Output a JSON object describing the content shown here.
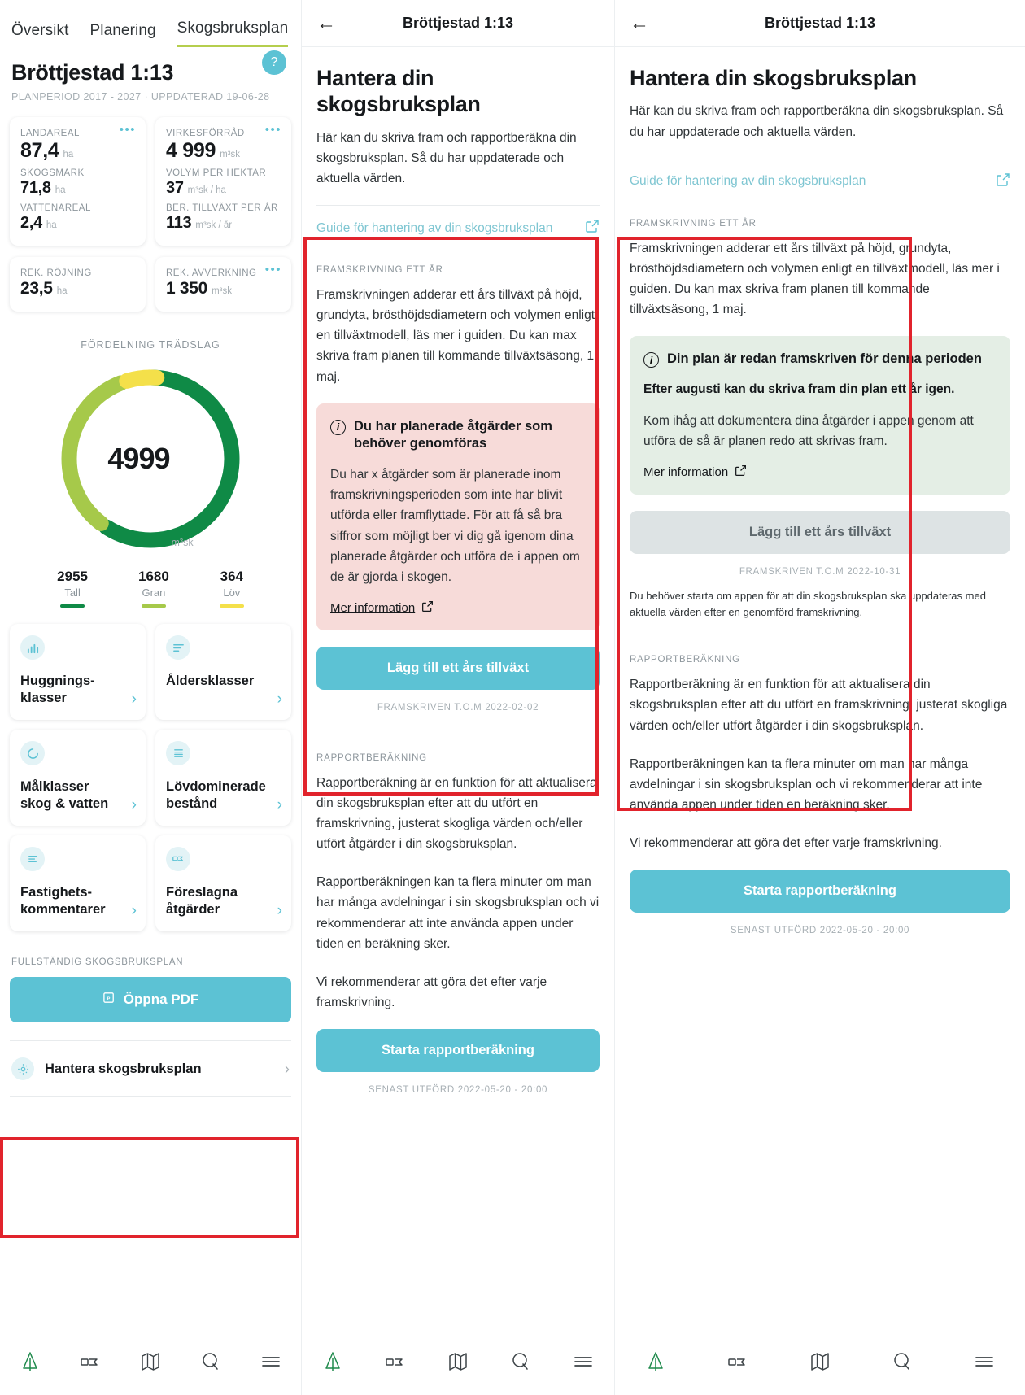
{
  "left": {
    "tabs": [
      {
        "label": "Översikt",
        "active": false
      },
      {
        "label": "Planering",
        "active": false
      },
      {
        "label": "Skogsbruksplan",
        "active": true
      }
    ],
    "title": "Bröttjestad 1:13",
    "subtitle": "PLANPERIOD 2017 - 2027 · UPPDATERAD 19-06-28",
    "help_icon": "?",
    "stats_card_1": [
      {
        "label": "LANDAREAL",
        "value": "87,4",
        "unit": "ha"
      },
      {
        "label": "SKOGSMARK",
        "value": "71,8",
        "unit": "ha"
      },
      {
        "label": "VATTENAREAL",
        "value": "2,4",
        "unit": "ha"
      }
    ],
    "stats_card_2": [
      {
        "label": "VIRKESFÖRRÅD",
        "value": "4 999",
        "unit": "m³sk"
      },
      {
        "label": "VOLYM PER HEKTAR",
        "value": "37",
        "unit": "m³sk / ha"
      },
      {
        "label": "BER. TILLVÄXT PER ÅR",
        "value": "113",
        "unit": "m³sk / år"
      }
    ],
    "stats_card_3": {
      "label": "REK. RÖJNING",
      "value": "23,5",
      "unit": "ha"
    },
    "stats_card_4": {
      "label": "REK. AVVERKNING",
      "value": "1 350",
      "unit": "m³sk"
    },
    "dots_label": "•••",
    "tiles": [
      {
        "label": "Huggnings-\nklasser",
        "icon": "bar-chart-icon"
      },
      {
        "label": "Åldersklasser",
        "icon": "list-lines-icon"
      },
      {
        "label": "Målklasser\nskog & vatten",
        "icon": "donut-icon"
      },
      {
        "label": "Lövdominerade\nbestånd",
        "icon": "document-lines-icon"
      },
      {
        "label": "Fastighets-\nkommentarer",
        "icon": "notes-icon"
      },
      {
        "label": "Föreslagna\nåtgärder",
        "icon": "tag-icon"
      }
    ],
    "full_plan_label": "FULLSTÄNDIG SKOGSBRUKSPLAN",
    "open_pdf_label": "Öppna PDF",
    "manage_row_label": "Hantera skogsbruksplan",
    "chevron": "›"
  },
  "chart_data": {
    "type": "pie",
    "title": "FÖRDELNING TRÄDSLAG",
    "center_value": "4999",
    "center_unit": "m³sk",
    "categories": [
      "Tall",
      "Gran",
      "Löv"
    ],
    "values": [
      2955,
      1680,
      364
    ],
    "colors": [
      "#0f8a46",
      "#a6c94a",
      "#f4e04a"
    ],
    "total": 4999,
    "legend_position": "bottom",
    "donut": true
  },
  "detail": {
    "topbar_title": "Bröttjestad 1:13",
    "back_icon": "←",
    "heading": "Hantera din skogsbruksplan",
    "intro": "Här kan du skriva fram och rapportberäkna din skogsbruksplan. Så du har uppdaterade och aktuella värden.",
    "guide_link": "Guide för hantering av din skogsbruksplan",
    "framskrivning_label": "FRAMSKRIVNING ETT ÅR",
    "framskrivning_body": "Framskrivningen adderar ett års tillväxt på höjd, grundyta, brösthöjdsdiametern och volymen enligt en tillväxtmodell, läs mer i guiden. Du kan max skriva fram planen till kommande tillväxtsäsong, 1 maj.",
    "rapport_label": "RAPPORTBERÄKNING",
    "rapport_p1": "Rapportberäkning är en funktion för att aktualisera din skogsbruksplan efter att du utfört en framskrivning, justerat skogliga värden och/eller utfört åtgärder i din skogsbruksplan.",
    "rapport_p2": "Rapportberäkningen kan ta flera minuter om man har många avdelningar i sin skogsbruksplan och vi rekommenderar att inte använda appen under tiden en beräkning sker.",
    "rapport_p3": "Vi rekommenderar att göra det efter varje framskrivning.",
    "start_report_label": "Starta rapportberäkning",
    "last_run_meta": "SENAST UTFÖRD 2022-05-20 - 20:00"
  },
  "mid_state": {
    "alert_title": "Du har planerade åtgärder som behöver genomföras",
    "alert_body": "Du har x åtgärder som är planerade inom framskrivningsperioden som inte har blivit utförda eller framflyttade. För att få så bra siffror som möjligt ber vi dig gå igenom dina planerade åtgärder och utföra de i appen om de är gjorda i skogen.",
    "alert_link": "Mer information",
    "cta_label": "Lägg till ett års tillväxt",
    "cta_meta": "FRAMSKRIVEN T.O.M 2022-02-02",
    "info_icon": "i"
  },
  "right_state": {
    "alert_title": "Din plan är redan framskriven för denna perioden",
    "alert_strong": "Efter augusti kan du skriva fram din plan ett år igen.",
    "alert_body": "Kom ihåg att dokumentera dina åtgärder i appen genom att utföra de så är planen redo att skrivas fram.",
    "alert_link": "Mer information",
    "cta_label": "Lägg till ett års tillväxt",
    "cta_meta": "FRAMSKRIVEN T.O.M 2022-10-31",
    "note": "Du behöver starta om appen för att din skogsbruksplan ska uppdateras med aktuella värden efter en genomförd framskrivning.",
    "info_icon": "i"
  },
  "bottom_nav": [
    {
      "icon": "tree-icon",
      "active": true
    },
    {
      "icon": "field-icon",
      "active": false
    },
    {
      "icon": "map-icon",
      "active": false
    },
    {
      "icon": "search-location-icon",
      "active": false
    },
    {
      "icon": "menu-icon",
      "active": false
    }
  ],
  "colors": {
    "accent": "#5cc2d4",
    "annotation": "#e1232c",
    "tall": "#0f8a46",
    "gran": "#a6c94a",
    "lov": "#f4e04a",
    "alert_pink": "#f7dbd9",
    "alert_green": "#e4eee5"
  }
}
